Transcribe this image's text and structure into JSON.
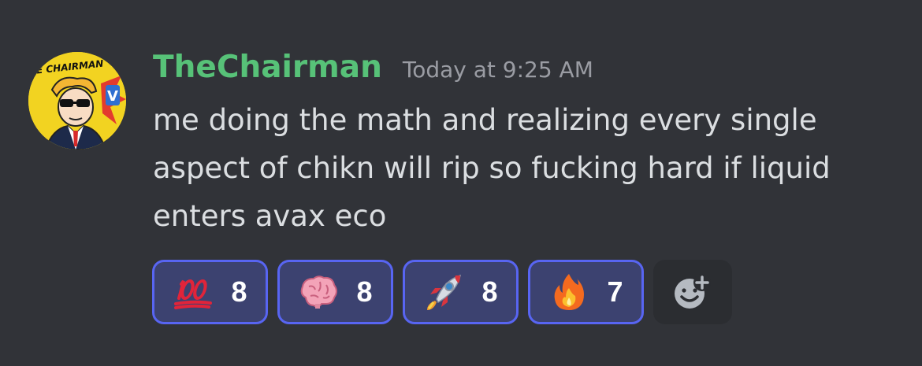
{
  "message": {
    "avatar_icon": "the-chairman-avatar",
    "avatar_text": "THE CHAIRMAN",
    "username": "TheChairman",
    "username_color": "#57c278",
    "timestamp": "Today at 9:25 AM",
    "content": "me doing the math and realizing every single aspect of chikn will rip so fucking hard if liquid enters avax eco"
  },
  "reactions": [
    {
      "emoji": "hundred-points-icon",
      "count": "8"
    },
    {
      "emoji": "brain-icon",
      "count": "8"
    },
    {
      "emoji": "rocket-icon",
      "count": "8"
    },
    {
      "emoji": "fire-icon",
      "count": "7"
    }
  ],
  "add_reaction_icon": "add-reaction-icon",
  "colors": {
    "background": "#313338",
    "reaction_bg": "#3c4270",
    "reaction_border": "#5865f2"
  }
}
